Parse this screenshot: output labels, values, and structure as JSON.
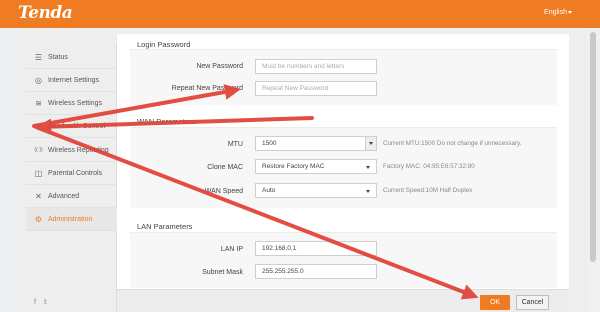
{
  "brand": {
    "logo": "Tenda",
    "language": "English"
  },
  "colors": {
    "accent": "#ef7b22",
    "annotation": "#e2453a"
  },
  "sidebar": {
    "items": [
      {
        "label": "Status",
        "icon": "status-icon",
        "glyph": "☰"
      },
      {
        "label": "Internet Settings",
        "icon": "globe-icon",
        "glyph": "◎"
      },
      {
        "label": "Wireless Settings",
        "icon": "wifi-icon",
        "glyph": "≋"
      },
      {
        "label": "Bandwidth Control",
        "icon": "bandwidth-icon",
        "glyph": "∿"
      },
      {
        "label": "Wireless Repeating",
        "icon": "repeater-icon",
        "glyph": "((·))"
      },
      {
        "label": "Parental Controls",
        "icon": "parental-icon",
        "glyph": "◫"
      },
      {
        "label": "Advanced",
        "icon": "tools-icon",
        "glyph": "✕"
      },
      {
        "label": "Administration",
        "icon": "gear-icon",
        "glyph": "⚙"
      }
    ],
    "social": "f  𝕥"
  },
  "login": {
    "title": "Login Password",
    "new_label": "New Password",
    "new_placeholder": "Must be numbers and letters",
    "repeat_label": "Repeat New Password",
    "repeat_placeholder": "Repeat New Password"
  },
  "wan": {
    "title": "WAN Parameters",
    "mtu_label": "MTU",
    "mtu_value": "1500",
    "mtu_hint": "Current MTU:1500 Do not change if unnecessary.",
    "mac_label": "Clone MAC",
    "mac_value": "Restore Factory MAC",
    "mac_hint": "Factory MAC: 04:95:E6:57:32:80",
    "speed_label": "WAN Speed",
    "speed_value": "Auto",
    "speed_hint": "Current Speed:10M Half Duplex"
  },
  "lan": {
    "title": "LAN Parameters",
    "ip_label": "LAN IP",
    "ip_value": "192.168.0.1",
    "mask_label": "Subnet Mask",
    "mask_value": "255.255.255.0"
  },
  "footer": {
    "ok": "OK",
    "cancel": "Cancel"
  }
}
